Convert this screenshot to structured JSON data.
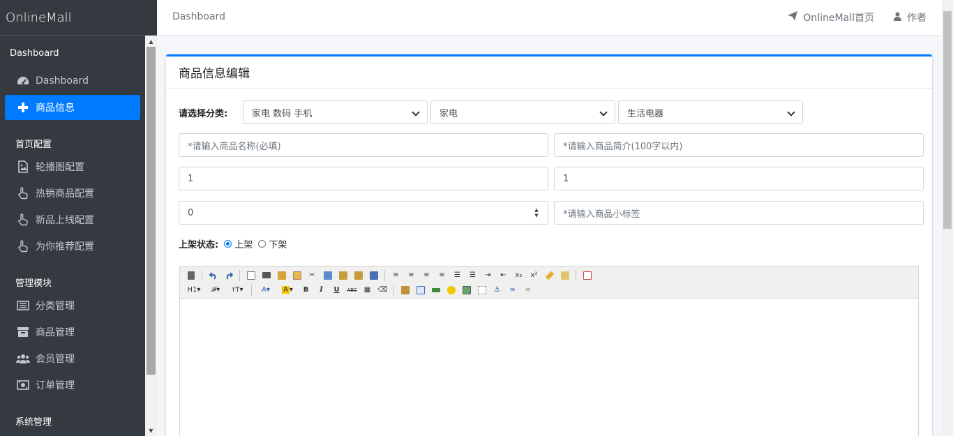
{
  "brand": "OnlineMall",
  "topnav": {
    "breadcrumb": "Dashboard",
    "home_link": "OnlineMall首页",
    "author_link": "作者"
  },
  "sidebar": {
    "sections": [
      {
        "header": "Dashboard",
        "items": [
          {
            "label": "Dashboard",
            "icon": "tachometer-icon"
          },
          {
            "label": "商品信息",
            "icon": "plus-icon",
            "active": true
          }
        ]
      },
      {
        "header": "首页配置",
        "items": [
          {
            "label": "轮播图配置",
            "icon": "image-icon"
          },
          {
            "label": "热销商品配置",
            "icon": "hand-pointer-icon"
          },
          {
            "label": "新品上线配置",
            "icon": "hand-pointer-icon"
          },
          {
            "label": "为你推荐配置",
            "icon": "hand-pointer-icon"
          }
        ]
      },
      {
        "header": "管理模块",
        "items": [
          {
            "label": "分类管理",
            "icon": "list-icon"
          },
          {
            "label": "商品管理",
            "icon": "archive-icon"
          },
          {
            "label": "会员管理",
            "icon": "users-icon"
          },
          {
            "label": "订单管理",
            "icon": "money-icon"
          }
        ]
      },
      {
        "header": "系统管理",
        "items": []
      }
    ]
  },
  "card": {
    "title": "商品信息编辑",
    "category_label": "请选择分类:",
    "category_selects": [
      "家电 数码 手机",
      "家电",
      "生活电器"
    ],
    "fields": {
      "name_placeholder": "*请输入商品名称(必填)",
      "intro_placeholder": "*请输入商品简介(100字以内)",
      "original_price": "1",
      "selling_price": "1",
      "stock": "0",
      "tag_placeholder": "*请输入商品小标签"
    },
    "status_label": "上架状态:",
    "status_options": [
      "上架",
      "下架"
    ],
    "status_selected": "上架"
  }
}
